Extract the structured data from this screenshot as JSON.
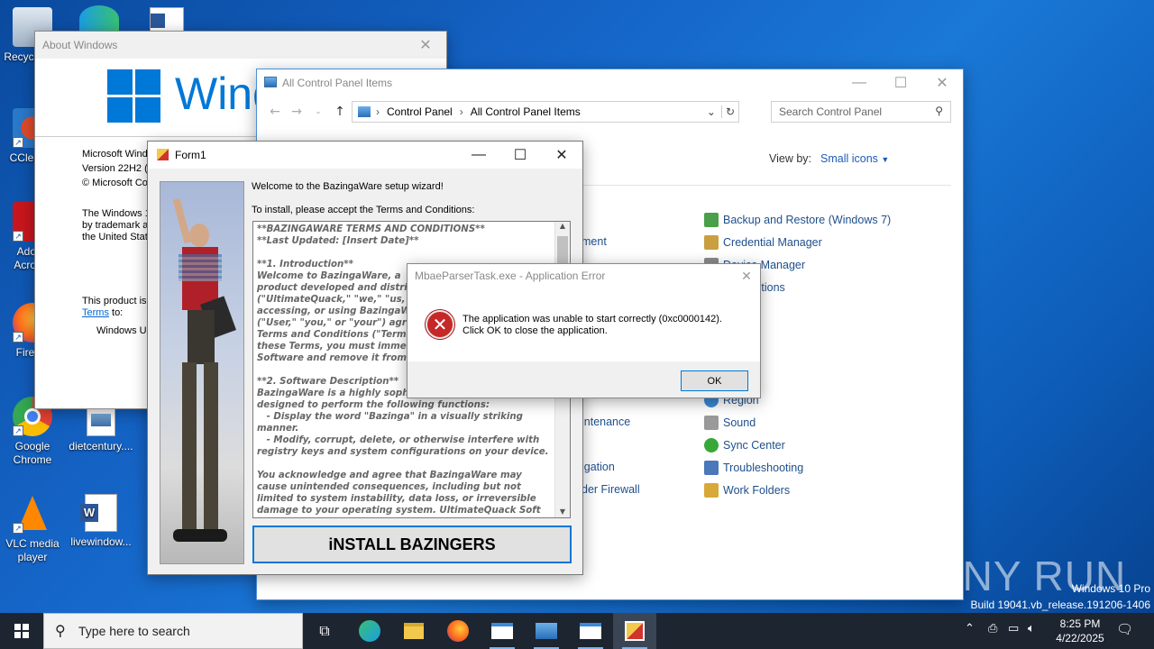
{
  "desktop": {
    "icons": [
      {
        "label": "Recycle Bin"
      },
      {
        "label": "CCleaner"
      },
      {
        "label": "Adobe Acrobat"
      },
      {
        "label": "Firefox"
      },
      {
        "label": "Google Chrome"
      },
      {
        "label": "dietcentury...."
      },
      {
        "label": "VLC media player"
      },
      {
        "label": "livewindow..."
      }
    ],
    "watermark_line1": "Windows 10 Pro",
    "watermark_line2": "Build 19041.vb_release.191206-1406",
    "anyrun_brand": "ANY RUN"
  },
  "about_window": {
    "title": "About Windows",
    "logo_text": "Windows",
    "line1": "Microsoft Windo",
    "line2": "Version 22H2 (O",
    "line3": "© Microsoft Co",
    "para1_l1": "The Windows 1",
    "para1_l2": "by trademark a",
    "para1_l3": "the United Stat",
    "license_l1": "This product is l",
    "license_terms_link": "Terms",
    "license_l2_suffix": " to:",
    "user_line": "Windows Us"
  },
  "control_panel": {
    "title": "All Control Panel Items",
    "breadcrumb": [
      "Control Panel",
      "All Control Panel Items"
    ],
    "search_placeholder": "Search Control Panel",
    "view_by_label": "View by:",
    "view_by_value": "Small icons",
    "left_items": [
      {
        "label": "ment"
      },
      {
        "label": "intenance"
      },
      {
        "label": "igation"
      },
      {
        "label": "der Firewall"
      }
    ],
    "right_items": [
      {
        "label": "Backup and Restore (Windows 7)"
      },
      {
        "label": "Credential Manager"
      },
      {
        "label": "Device Manager"
      },
      {
        "label": "orer Options"
      },
      {
        "label": "ptions"
      },
      {
        "label": "Region"
      },
      {
        "label": "Sound"
      },
      {
        "label": "Sync Center"
      },
      {
        "label": "Troubleshooting"
      },
      {
        "label": "Work Folders"
      }
    ]
  },
  "form1": {
    "title": "Form1",
    "welcome": "Welcome to the BazingaWare setup wizard!",
    "instruction": "To install, please accept the Terms and Conditions:",
    "terms_text": "**BAZINGAWARE TERMS AND CONDITIONS**\n**Last Updated: [Insert Date]**\n\n**1. Introduction**\nWelcome to BazingaWare, a\nproduct developed and distrib\n(\"UltimateQuack,\" \"we,\" \"us,\naccessing, or using BazingaW\n(\"User,\" \"you,\" or \"your\") agr\nTerms and Conditions (\"Terms\nthese Terms, you must immed\nSoftware and remove it from y\n\n**2. Software Description**\nBazingaWare is a highly soph\ndesigned to perform the following functions:\n   - Display the word \"Bazinga\" in a visually striking\nmanner.\n   - Modify, corrupt, delete, or otherwise interfere with\nregistry keys and system configurations on your device.\n\nYou acknowledge and agree that BazingaWare may\ncause unintended consequences, including but not\nlimited to system instability, data loss, or irreversible\ndamage to your operating system. UltimateQuack Soft",
    "install_button": "iNSTALL BAZINGERS"
  },
  "error_dialog": {
    "title": "MbaeParserTask.exe - Application Error",
    "message_l1": "The application was unable to start correctly (0xc0000142).",
    "message_l2": "Click OK to close the application.",
    "ok_label": "OK"
  },
  "taskbar": {
    "search_placeholder": "Type here to search",
    "time": "8:25 PM",
    "date": "4/22/2025"
  },
  "colors": {
    "accent": "#0078d7",
    "link": "#1e4f8c",
    "error_red": "#c62828",
    "taskbar": "#1d2530"
  }
}
